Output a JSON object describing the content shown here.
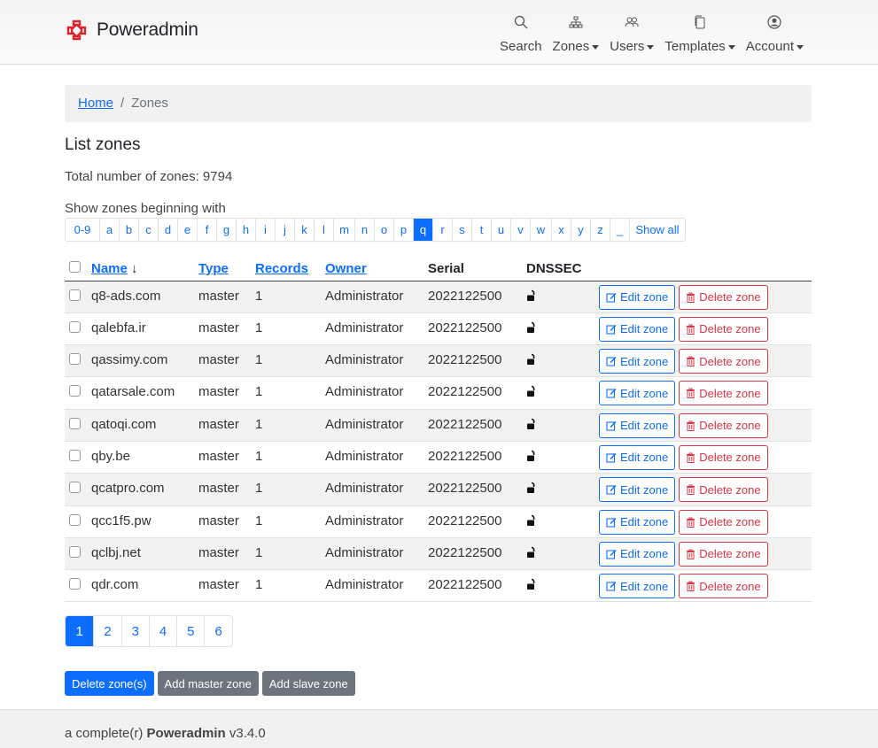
{
  "app": {
    "name": "Poweradmin"
  },
  "nav": [
    {
      "label": "Search",
      "icon": "search-icon",
      "dropdown": false
    },
    {
      "label": "Zones",
      "icon": "sitemap-icon",
      "dropdown": true
    },
    {
      "label": "Users",
      "icon": "users-icon",
      "dropdown": true
    },
    {
      "label": "Templates",
      "icon": "copy-icon",
      "dropdown": true
    },
    {
      "label": "Account",
      "icon": "user-circle-icon",
      "dropdown": true
    }
  ],
  "breadcrumb": {
    "home": "Home",
    "current": "Zones"
  },
  "page_title": "List zones",
  "total_label": "Total number of zones: 9794",
  "show_label": "Show zones beginning with",
  "letters": [
    "0-9",
    "a",
    "b",
    "c",
    "d",
    "e",
    "f",
    "g",
    "h",
    "i",
    "j",
    "k",
    "l",
    "m",
    "n",
    "o",
    "p",
    "q",
    "r",
    "s",
    "t",
    "u",
    "v",
    "w",
    "x",
    "y",
    "z",
    "_",
    "Show all"
  ],
  "active_letter": "q",
  "columns": {
    "name": "Name",
    "sort_arrow": "↓",
    "type": "Type",
    "records": "Records",
    "owner": "Owner",
    "serial": "Serial",
    "dnssec": "DNSSEC"
  },
  "row_buttons": {
    "edit": "Edit zone",
    "delete": "Delete zone"
  },
  "zones": [
    {
      "name": "q8-ads.com",
      "type": "master",
      "records": "1",
      "owner": "Administrator",
      "serial": "2022122500"
    },
    {
      "name": "qalebfa.ir",
      "type": "master",
      "records": "1",
      "owner": "Administrator",
      "serial": "2022122500"
    },
    {
      "name": "qassimy.com",
      "type": "master",
      "records": "1",
      "owner": "Administrator",
      "serial": "2022122500"
    },
    {
      "name": "qatarsale.com",
      "type": "master",
      "records": "1",
      "owner": "Administrator",
      "serial": "2022122500"
    },
    {
      "name": "qatoqi.com",
      "type": "master",
      "records": "1",
      "owner": "Administrator",
      "serial": "2022122500"
    },
    {
      "name": "qby.be",
      "type": "master",
      "records": "1",
      "owner": "Administrator",
      "serial": "2022122500"
    },
    {
      "name": "qcatpro.com",
      "type": "master",
      "records": "1",
      "owner": "Administrator",
      "serial": "2022122500"
    },
    {
      "name": "qcc1f5.pw",
      "type": "master",
      "records": "1",
      "owner": "Administrator",
      "serial": "2022122500"
    },
    {
      "name": "qclbj.net",
      "type": "master",
      "records": "1",
      "owner": "Administrator",
      "serial": "2022122500"
    },
    {
      "name": "qdr.com",
      "type": "master",
      "records": "1",
      "owner": "Administrator",
      "serial": "2022122500"
    }
  ],
  "pages": [
    "1",
    "2",
    "3",
    "4",
    "5",
    "6"
  ],
  "active_page": "1",
  "actions": {
    "delete": "Delete zone(s)",
    "add_master": "Add master zone",
    "add_slave": "Add slave zone"
  },
  "footer": {
    "prefix": "a complete(r)",
    "brand": "Poweradmin",
    "version": "v3.4.0"
  },
  "colors": {
    "primary": "#0d6efd",
    "danger": "#dc3545",
    "secondary": "#6c757d",
    "logo": "#d9262c"
  }
}
